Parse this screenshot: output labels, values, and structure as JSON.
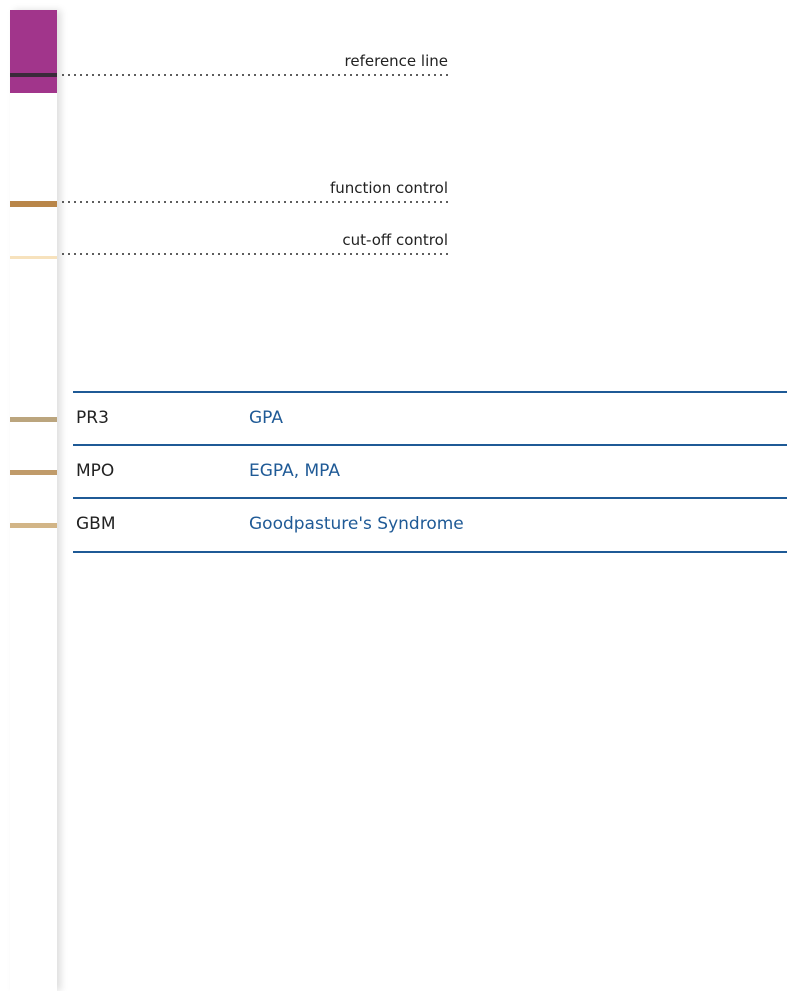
{
  "colors": {
    "strip_head": "#a1358b",
    "reference_band": "#3a2a3a",
    "function_band": "#b98649",
    "cutoff_band": "#f7e2bd",
    "pr3_band": "#bba57e",
    "mpo_band": "#c09b6a",
    "gbm_band": "#d2b587",
    "table_line": "#1f5a96",
    "disease_text": "#1f5a96"
  },
  "markers": [
    {
      "label": "reference line"
    },
    {
      "label": "function control"
    },
    {
      "label": "cut-off control"
    }
  ],
  "rows": [
    {
      "antigen": "PR3",
      "disease": "GPA"
    },
    {
      "antigen": "MPO",
      "disease": "EGPA, MPA"
    },
    {
      "antigen": "GBM",
      "disease": "Goodpasture's Syndrome"
    }
  ]
}
